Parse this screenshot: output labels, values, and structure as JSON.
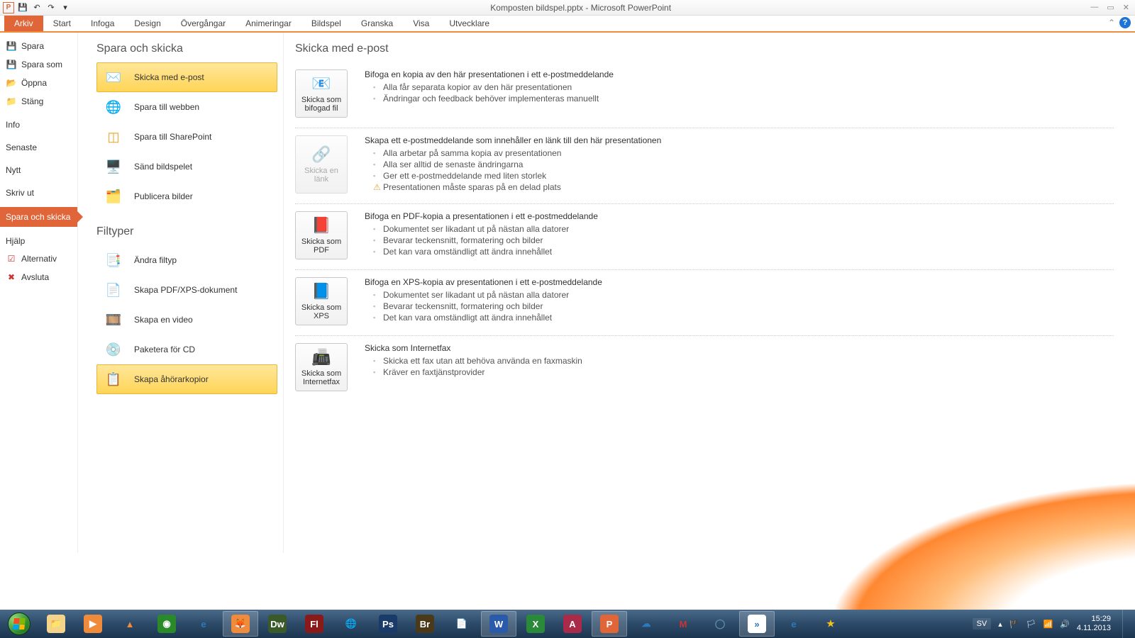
{
  "title": "Komposten bildspel.pptx  -  Microsoft PowerPoint",
  "ribbon": [
    "Arkiv",
    "Start",
    "Infoga",
    "Design",
    "Övergångar",
    "Animeringar",
    "Bildspel",
    "Granska",
    "Visa",
    "Utvecklare"
  ],
  "bsLeft": {
    "save": "Spara",
    "saveAs": "Spara som",
    "open": "Öppna",
    "close": "Stäng",
    "info": "Info",
    "recent": "Senaste",
    "new": "Nytt",
    "print": "Skriv ut",
    "saveSend": "Spara och skicka",
    "help": "Hjälp",
    "options": "Alternativ",
    "exit": "Avsluta"
  },
  "mid": {
    "h1": "Spara och skicka",
    "items1": [
      "Skicka med e-post",
      "Spara till webben",
      "Spara till SharePoint",
      "Sänd bildspelet",
      "Publicera bilder"
    ],
    "h2": "Filtyper",
    "items2": [
      "Ändra filtyp",
      "Skapa PDF/XPS-dokument",
      "Skapa en video",
      "Paketera för CD",
      "Skapa åhörarkopior"
    ]
  },
  "right": {
    "heading": "Skicka med e-post",
    "sections": [
      {
        "btn": "Skicka som bifogad fil",
        "head": "Bifoga en kopia av den här presentationen i ett e-postmeddelande",
        "bullets": [
          "Alla får separata kopior av den här presentationen",
          "Ändringar och feedback behöver implementeras manuellt"
        ]
      },
      {
        "btn": "Skicka en länk",
        "disabled": true,
        "head": "Skapa ett e-postmeddelande som innehåller en länk till den här presentationen",
        "bullets": [
          "Alla arbetar på samma kopia av presentationen",
          "Alla ser alltid de senaste ändringarna",
          "Ger ett e-postmeddelande med liten storlek"
        ],
        "warn": "Presentationen måste sparas på en delad plats"
      },
      {
        "btn": "Skicka som PDF",
        "head": "Bifoga en PDF-kopia a presentationen i ett e-postmeddelande",
        "bullets": [
          "Dokumentet ser likadant ut på nästan alla datorer",
          "Bevarar teckensnitt, formatering och bilder",
          "Det kan vara omständligt att ändra innehållet"
        ]
      },
      {
        "btn": "Skicka som XPS",
        "head": "Bifoga en XPS-kopia av presentationen i ett e-postmeddelande",
        "bullets": [
          "Dokumentet ser likadant ut på nästan alla datorer",
          "Bevarar teckensnitt, formatering och bilder",
          "Det kan vara omständligt att ändra innehållet"
        ]
      },
      {
        "btn": "Skicka som Internetfax",
        "head": "Skicka som Internetfax",
        "bullets": [
          "Skicka ett fax utan att behöva använda en faxmaskin",
          "Kräver en faxtjänstprovider"
        ]
      }
    ]
  },
  "tray": {
    "lang": "SV",
    "time": "15:29",
    "date": "4.11.2013"
  }
}
